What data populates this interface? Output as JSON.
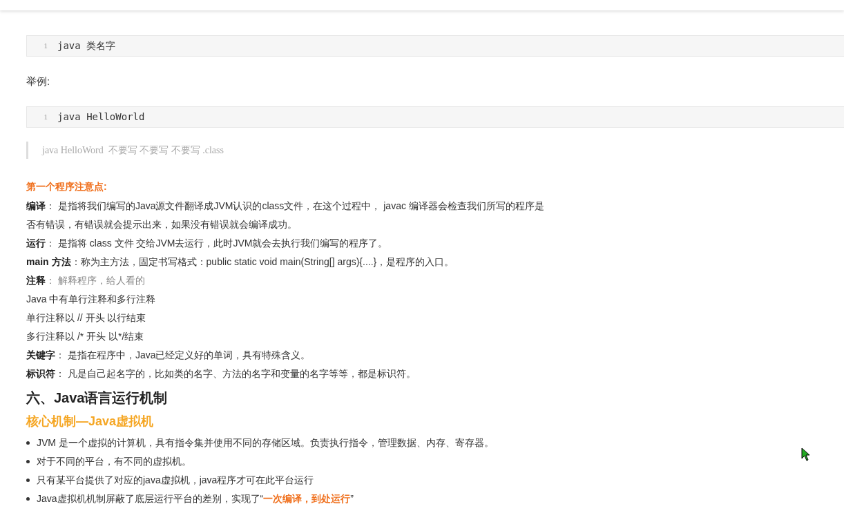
{
  "code_blocks_top": [
    {
      "line_number": "1",
      "code": "java 类名字"
    }
  ],
  "example_label": "举例:",
  "code_blocks_bottom": [
    {
      "line_number": "1",
      "code": "java HelloWorld"
    }
  ],
  "blockquote": "java HelloWord  不要写 不要写 不要写 .class",
  "notes_title": "第一个程序注意点:",
  "notes": [
    {
      "label": "编译",
      "text": "： 是指将我们编写的Java源文件翻译成JVM认识的class文件，在这个过程中， javac 编译器会检查我们所写的程序是否有错误，有错误就会提示出来，如果没有错误就会编译成功。",
      "muted": false
    },
    {
      "label": "运行",
      "text": "： 是指将 class 文件 交给JVM去运行，此时JVM就会去执行我们编写的程序了。",
      "muted": false
    },
    {
      "label": "main 方法",
      "text": "：称为主方法，固定书写格式：public static void main(String[] args){....}，是程序的入口。",
      "muted": false
    },
    {
      "label": "注释",
      "text": "： 解释程序，给人看的",
      "muted": true
    },
    {
      "text": "Java 中有单行注释和多行注释",
      "muted": false
    },
    {
      "text": "单行注释以 // 开头 以行结束",
      "muted": false
    },
    {
      "text": "多行注释以 /* 开头  以*/结束",
      "muted": false
    },
    {
      "label": "关键字",
      "text": "： 是指在程序中，Java已经定义好的单词，具有特殊含义。",
      "muted": false
    },
    {
      "label": "标识符",
      "text": "： 凡是自己起名字的，比如类的名字、方法的名字和变量的名字等等，都是标识符。",
      "muted": false
    }
  ],
  "section_heading": "六、Java语言运行机制",
  "subheading": "核心机制—Java虚拟机",
  "bullets": [
    {
      "parts": [
        {
          "kind": "plain",
          "text": "JVM 是一个虚拟的计算机，具有指令集并使用不同的存储区域。负责执行指令，管理数据、内存、寄存器。"
        }
      ]
    },
    {
      "parts": [
        {
          "kind": "plain",
          "text": "对于不同的平台，有不同的虚拟机。"
        }
      ]
    },
    {
      "parts": [
        {
          "kind": "plain",
          "text": "只有某平台提供了对应的java虚拟机，java程序才可在此平台运行"
        }
      ]
    },
    {
      "parts": [
        {
          "kind": "plain",
          "text": "Java虚拟机机制屏蔽了底层运行平台的差别，实现了“"
        },
        {
          "kind": "emphasis",
          "text": "一次编译，到处运行"
        },
        {
          "kind": "plain",
          "text": "”"
        }
      ]
    }
  ]
}
